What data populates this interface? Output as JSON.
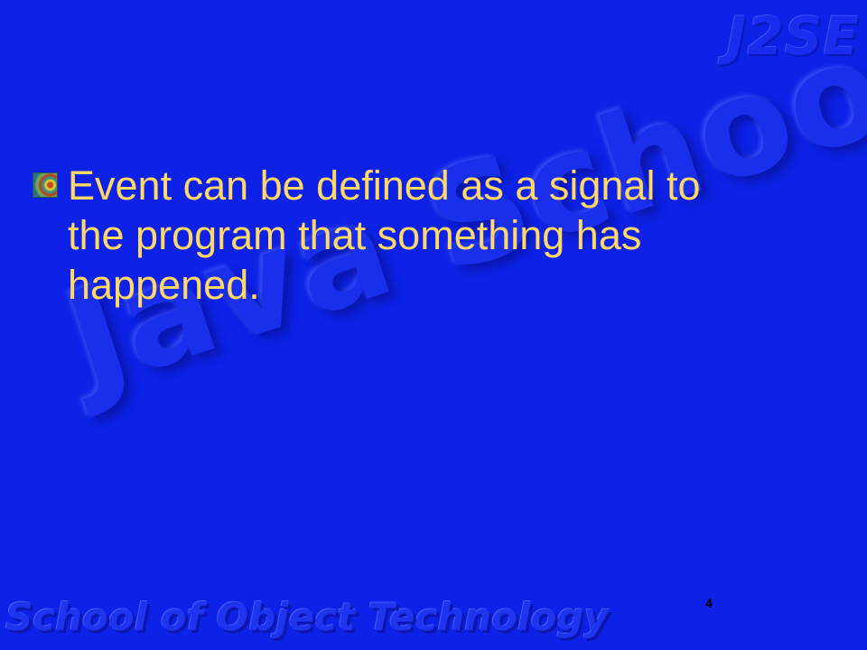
{
  "slide": {
    "watermark_top": "J2SE",
    "watermark_center": "Java School",
    "watermark_footer": "School of Object Technology",
    "bullets": [
      {
        "icon": "textured-square-bullet-icon",
        "text": "Event can be defined as a signal to the program that something has happened."
      }
    ],
    "page_number": "4"
  },
  "colors": {
    "background": "#0d22e6",
    "text": "#ffd866",
    "page_number": "#000000"
  }
}
